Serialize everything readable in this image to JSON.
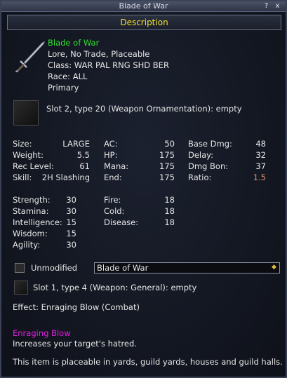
{
  "window": {
    "title": "Blade of War",
    "help_label": "?",
    "close_label": "x"
  },
  "tab": {
    "label": "Description"
  },
  "item": {
    "name": "Blade of War",
    "flags": "Lore, No Trade, Placeable",
    "class": "Class: WAR PAL RNG SHD BER",
    "race": "Race: ALL",
    "slot": "Primary"
  },
  "aug_slot_2": "Slot 2, type 20 (Weapon Ornamentation): empty",
  "stats_col1": [
    {
      "label": "Size:",
      "value": "LARGE"
    },
    {
      "label": "Weight:",
      "value": "5.5"
    },
    {
      "label": "Rec Level:",
      "value": "61"
    },
    {
      "label": "Skill:",
      "value": "2H Slashing"
    }
  ],
  "stats_col2": [
    {
      "label": "AC:",
      "value": "50"
    },
    {
      "label": "HP:",
      "value": "175"
    },
    {
      "label": "Mana:",
      "value": "175"
    },
    {
      "label": "End:",
      "value": "175"
    }
  ],
  "stats_col3": [
    {
      "label": "Base Dmg:",
      "value": "48"
    },
    {
      "label": "Delay:",
      "value": "32"
    },
    {
      "label": "Dmg Bon:",
      "value": "37"
    },
    {
      "label": "Ratio:",
      "value": "1.5"
    }
  ],
  "attrs": [
    {
      "label": "Strength:",
      "value": "30"
    },
    {
      "label": "Stamina:",
      "value": "30"
    },
    {
      "label": "Intelligence:",
      "value": "15"
    },
    {
      "label": "Wisdom:",
      "value": "15"
    },
    {
      "label": "Agility:",
      "value": "30"
    }
  ],
  "resists": [
    {
      "label": "Fire:",
      "value": "18"
    },
    {
      "label": "Cold:",
      "value": "18"
    },
    {
      "label": "Disease:",
      "value": "18"
    }
  ],
  "unmodified_label": "Unmodified",
  "dropdown_value": "Blade of War",
  "aug_slot_1": "Slot 1, type 4 (Weapon: General): empty",
  "effect": "Effect: Enraging Blow (Combat)",
  "spell_name": "Enraging Blow",
  "spell_desc": "Increases your target's hatred.",
  "placeable_note": "This item is placeable in yards, guild yards, houses and guild halls.",
  "colors": {
    "title_text": "#f0e030",
    "item_name": "#33dd33",
    "spell_name": "#e020e0",
    "ratio": "#e08f6a"
  }
}
